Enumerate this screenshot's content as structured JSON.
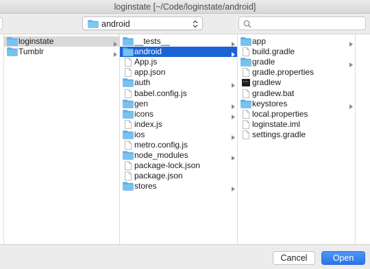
{
  "window": {
    "title": "loginstate [~/Code/loginstate/android]"
  },
  "toolbar": {
    "path_select": {
      "value": "android",
      "icon": "folder-icon"
    },
    "search": {
      "placeholder": "",
      "icon": "search-icon"
    }
  },
  "columns": [
    {
      "items": [
        {
          "label": "loginstate",
          "type": "folder",
          "has_children": true,
          "state": "selected-inactive"
        },
        {
          "label": "Tumblr",
          "type": "folder",
          "has_children": true,
          "state": ""
        }
      ]
    },
    {
      "items": [
        {
          "label": "__tests__",
          "type": "folder",
          "has_children": true,
          "state": ""
        },
        {
          "label": "android",
          "type": "folder",
          "has_children": true,
          "state": "selected-active"
        },
        {
          "label": "App.js",
          "type": "file",
          "has_children": false,
          "state": ""
        },
        {
          "label": "app.json",
          "type": "file",
          "has_children": false,
          "state": ""
        },
        {
          "label": "auth",
          "type": "folder",
          "has_children": true,
          "state": ""
        },
        {
          "label": "babel.config.js",
          "type": "file",
          "has_children": false,
          "state": ""
        },
        {
          "label": "gen",
          "type": "folder",
          "has_children": true,
          "state": ""
        },
        {
          "label": "icons",
          "type": "folder",
          "has_children": true,
          "state": ""
        },
        {
          "label": "index.js",
          "type": "file",
          "has_children": false,
          "state": ""
        },
        {
          "label": "ios",
          "type": "folder",
          "has_children": true,
          "state": ""
        },
        {
          "label": "metro.config.js",
          "type": "file",
          "has_children": false,
          "state": ""
        },
        {
          "label": "node_modules",
          "type": "folder",
          "has_children": true,
          "state": ""
        },
        {
          "label": "package-lock.json",
          "type": "file",
          "has_children": false,
          "state": ""
        },
        {
          "label": "package.json",
          "type": "file",
          "has_children": false,
          "state": ""
        },
        {
          "label": "stores",
          "type": "folder",
          "has_children": true,
          "state": ""
        }
      ]
    },
    {
      "items": [
        {
          "label": "app",
          "type": "folder",
          "has_children": true,
          "state": ""
        },
        {
          "label": "build.gradle",
          "type": "file",
          "has_children": false,
          "state": ""
        },
        {
          "label": "gradle",
          "type": "folder",
          "has_children": true,
          "state": ""
        },
        {
          "label": "gradle.properties",
          "type": "file",
          "has_children": false,
          "state": ""
        },
        {
          "label": "gradlew",
          "type": "exec",
          "has_children": false,
          "state": ""
        },
        {
          "label": "gradlew.bat",
          "type": "file",
          "has_children": false,
          "state": ""
        },
        {
          "label": "keystores",
          "type": "folder",
          "has_children": true,
          "state": ""
        },
        {
          "label": "local.properties",
          "type": "file",
          "has_children": false,
          "state": ""
        },
        {
          "label": "loginstate.iml",
          "type": "file",
          "has_children": false,
          "state": ""
        },
        {
          "label": "settings.gradle",
          "type": "file",
          "has_children": false,
          "state": ""
        }
      ]
    }
  ],
  "buttons": {
    "cancel": "Cancel",
    "open": "Open"
  },
  "colors": {
    "selection_active": "#1a64d6",
    "selection_inactive": "#d9d9d9",
    "folder": "#66b7ec",
    "primary_button": "#2b74e8"
  }
}
